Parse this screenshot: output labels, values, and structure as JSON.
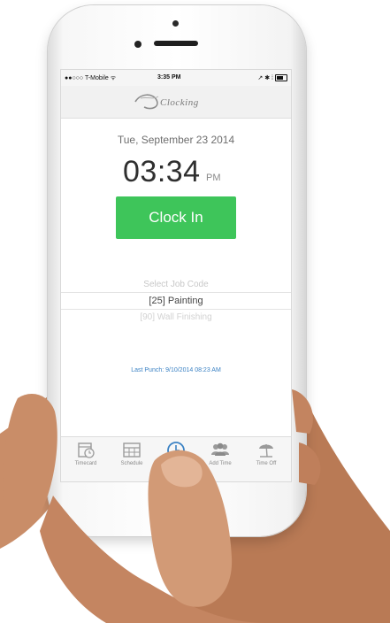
{
  "status_bar": {
    "carrier": "●●○○○ T-Mobile ᯤ",
    "time": "3:35 PM",
    "right_icons": "↗ ✱ ⁞"
  },
  "nav": {
    "logo_icon": "swoosh-logo-icon",
    "logo_text": "Clocking"
  },
  "main": {
    "date": "Tue, September 23 2014",
    "time": "03:34",
    "ampm": "PM",
    "clock_in_label": "Clock In",
    "job_picker": {
      "options": [
        "Select Job Code",
        "[25] Painting",
        "[90] Wall Finishing"
      ],
      "selected": "[25] Painting"
    },
    "last_punch": "Last Punch: 9/10/2014 08:23 AM"
  },
  "tabs": [
    {
      "label": "Timecard",
      "icon": "timecard-icon"
    },
    {
      "label": "Schedule",
      "icon": "schedule-icon"
    },
    {
      "label": "",
      "icon": "clock-icon"
    },
    {
      "label": "Add Time",
      "icon": "add-time-icon"
    },
    {
      "label": "Time Off",
      "icon": "time-off-icon"
    }
  ],
  "colors": {
    "accent_green": "#3ec55a",
    "link_blue": "#3b82c4"
  }
}
